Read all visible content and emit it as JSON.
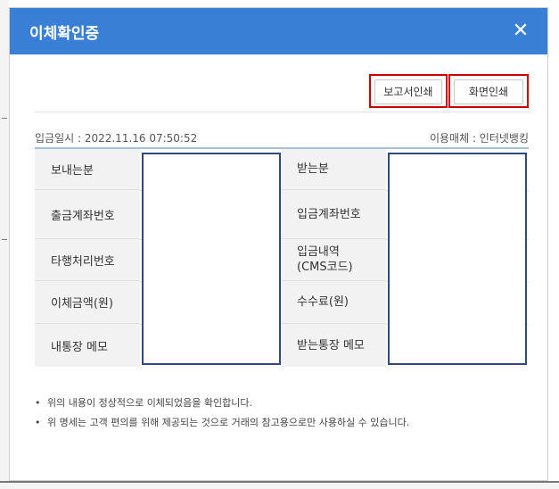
{
  "dialog": {
    "title": "이체확인증",
    "close_label": "✕"
  },
  "toolbar": {
    "report_print_label": "보고서인쇄",
    "screen_print_label": "화면인쇄"
  },
  "meta": {
    "deposit_datetime": "입금일시 : 2022.11.16 07:50:52",
    "channel": "이용매체 : 인터넷뱅킹"
  },
  "table": {
    "left_labels": [
      "보내는분",
      "출금계좌번호",
      "타행처리번호",
      "이체금액(원)",
      "내통장 메모"
    ],
    "right_labels": [
      "받는분",
      "입금계좌번호",
      "입금내역\n(CMS코드)",
      "수수료(원)",
      "받는통장 메모"
    ]
  },
  "notes": [
    "위의 내용이 정상적으로 이체되었음을 확인합니다.",
    "위 명세는 고객 편의를 위해 제공되는 것으로 거래의 참고용으로만 사용하실 수 있습니다."
  ],
  "colors": {
    "header": "#3a7fd6",
    "highlight_border": "#cc0000",
    "redaction_border": "#2f4a7d"
  }
}
